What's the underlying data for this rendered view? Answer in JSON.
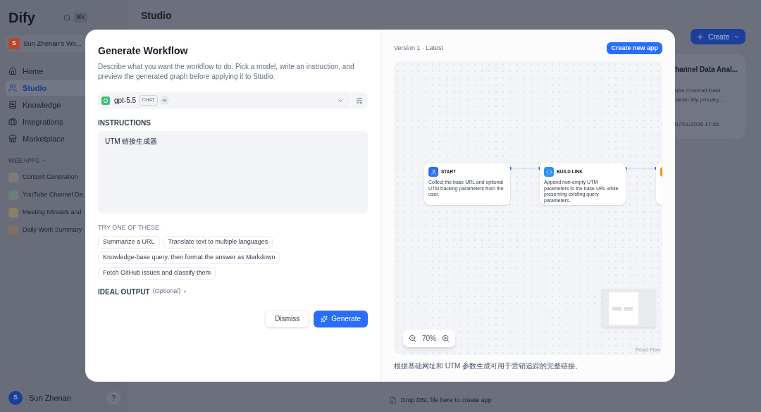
{
  "background": {
    "logo": "Dify",
    "search_shortcut": "⌘K",
    "page_title": "Studio",
    "workspace": {
      "initial": "S",
      "name": "Sun Zhenan's Wo..."
    },
    "nav": [
      {
        "label": "Home",
        "selected": false
      },
      {
        "label": "Studio",
        "selected": true
      },
      {
        "label": "Knowledge",
        "selected": false
      },
      {
        "label": "Integrations",
        "selected": false
      },
      {
        "label": "Marketplace",
        "selected": false
      }
    ],
    "web_apps_heading": "WEB APPS",
    "web_apps": [
      {
        "name": "Content Generation",
        "color": "#7e7b76"
      },
      {
        "name": "YouTube Channel Da",
        "color": "#6c7e7a"
      },
      {
        "name": "Meeting Minutes and",
        "color": "#8a8068"
      },
      {
        "name": "Daily Work Summary",
        "color": "#7f7062"
      }
    ],
    "create_button": "Create",
    "card": {
      "title": "hannel Data Anal...",
      "description": [
        "ube Channel Data",
        "racter My primary..."
      ],
      "date": "07/01/2026 17:56"
    },
    "user": {
      "initial": "S",
      "name": "Sun Zhenan"
    },
    "help": "?",
    "drop_hint": "Drop DSL file here to create app"
  },
  "modal": {
    "title": "Generate Workflow",
    "description": "Describe what you want the workflow to do. Pick a model, write an instruction, and preview the generated graph before applying it to Studio.",
    "model": {
      "name": "gpt-5.5",
      "badge": "CHAT"
    },
    "instructions_label": "INSTRUCTIONS",
    "instructions": "UTM 链接生成器",
    "suggestions_label": "TRY ONE OF THESE",
    "suggestions": [
      "Summarize a URL",
      "Translate text to multiple languages",
      "Knowledge-base query, then format the answer as Markdown",
      "Fetch GitHub issues and classify them"
    ],
    "ideal_output": {
      "label": "IDEAL OUTPUT",
      "hint": "(Optional)",
      "expanded": false
    },
    "dismiss_button": "Dismiss",
    "generate_button": "Generate",
    "preview": {
      "version": "Version 1 · Latest",
      "create_button": "Create new app",
      "nodes": [
        {
          "kind": "start",
          "title": "START",
          "description": "Collect the base URL and optional UTM tracking parameters from the user."
        },
        {
          "kind": "code",
          "title": "BUILD LINK",
          "description": "Append non-empty UTM parameters to the base URL while preserving existing query parameters."
        },
        {
          "kind": "output"
        }
      ],
      "zoom": "70%",
      "attribution": "React Flow",
      "caption": "根据基础网址和 UTM 参数生成可用于营销追踪的完整链接。"
    }
  }
}
